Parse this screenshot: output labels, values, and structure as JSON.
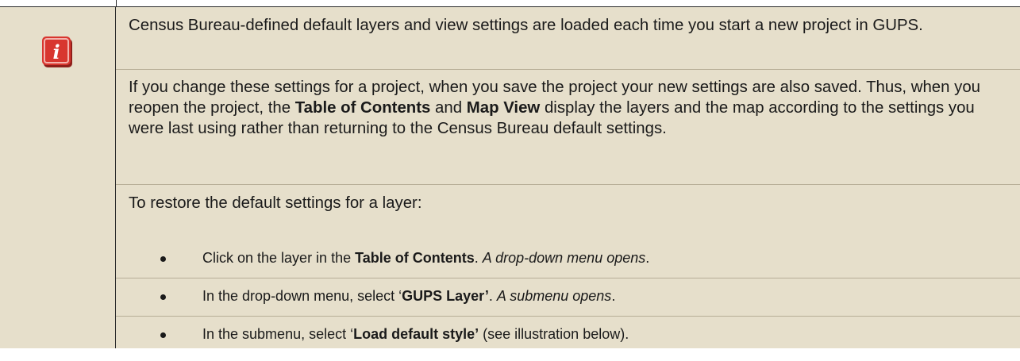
{
  "note": {
    "icon": "info-icon",
    "icon_glyph": "i",
    "icon_color": "#d8362f",
    "background_color": "#e6dfcb",
    "paragraphs": [
      {
        "text": "Census Bureau-defined default layers and view settings are loaded each time you start a new project in GUPS."
      },
      {
        "t1": "If you change these settings for a project, when you save the project your new settings are also saved. Thus, when you reopen the project, the ",
        "b1": "Table of Contents",
        "t2": " and ",
        "b2": "Map View",
        "t3": " display the layers and the map according to the settings you were last using rather than returning to the Census Bureau default settings."
      },
      {
        "text": "To restore the default settings for a layer:"
      }
    ],
    "steps": [
      {
        "t1": "Click on the layer in the ",
        "b1": "Table of Contents",
        "t2": ". ",
        "i1": "A drop-down menu opens",
        "t3": "."
      },
      {
        "t1": "In the drop-down menu, select ‘",
        "b1": "GUPS Layer’",
        "t2": ". ",
        "i1": "A submenu opens",
        "t3": "."
      },
      {
        "t1": "In the submenu, select ‘",
        "b1": "Load default style’",
        "t2": " (see illustration below).",
        "i1": "",
        "t3": ""
      }
    ]
  }
}
